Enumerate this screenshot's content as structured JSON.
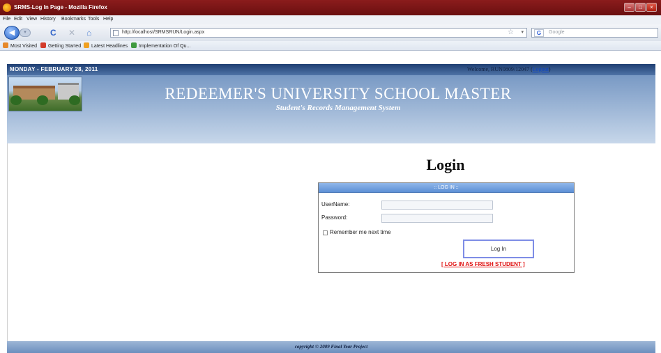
{
  "browser": {
    "window_title": "SRMS-Log In Page - Mozilla Firefox",
    "menu": [
      "File",
      "Edit",
      "View",
      "History",
      "Bookmarks",
      "Tools",
      "Help"
    ],
    "url": "http://localhost/SRMSRUN/Login.aspx",
    "search_placeholder": "Google",
    "bookmarks": [
      {
        "label": "Most Visited",
        "icon": "firefox-icon",
        "color": "#e6892a"
      },
      {
        "label": "Getting Started",
        "icon": "getting-started-icon",
        "color": "#d33b2a"
      },
      {
        "label": "Latest Headlines",
        "icon": "rss-icon",
        "color": "#f0a020"
      },
      {
        "label": "Implementation Of Qu...",
        "icon": "colorful-tile-icon",
        "color": "#3f9a3f"
      }
    ]
  },
  "site": {
    "date": "MONDAY - FEBRUARY 28, 2011",
    "welcome_prefix": "Welcome, RUN0809/12047 (",
    "welcome_link": "Logout",
    "welcome_suffix": ")",
    "title": "REDEEMER'S UNIVERSITY SCHOOL MASTER",
    "subtitle": "Student's Records Management System"
  },
  "login": {
    "heading": "Login",
    "box_title": ":: LOG IN ::",
    "username_label": "UserName:",
    "username_value": "",
    "password_label": "Password:",
    "password_value": "",
    "remember_label": "Remember me next time",
    "button_label": "Log In",
    "fresh_student_link": "[ LOG IN AS FRESH STUDENT ]"
  },
  "footer": {
    "text": "copyright © 2009 Final Year Project"
  },
  "colors": {
    "titlebar": "#7a1515",
    "header_blue": "#6c8fbe",
    "link_red": "#e01010",
    "button_border": "#7e8de6"
  }
}
